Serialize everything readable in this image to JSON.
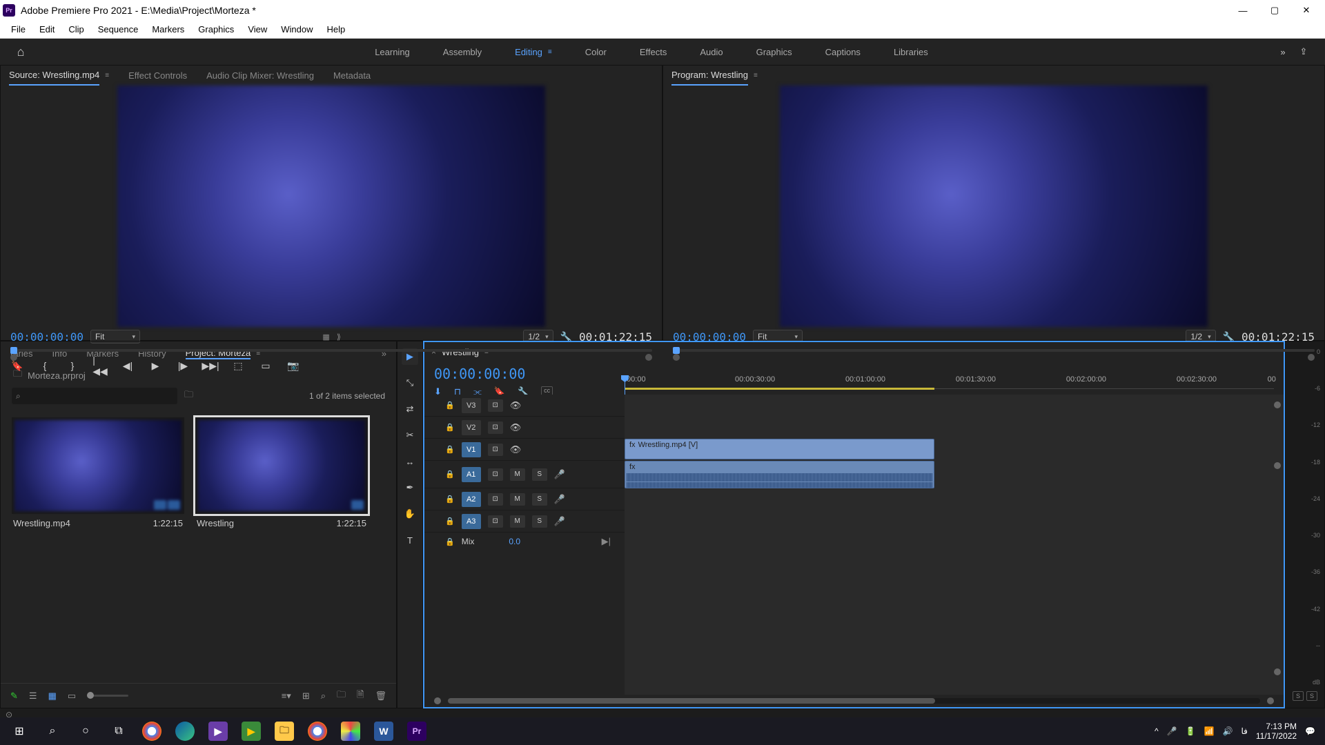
{
  "titlebar": {
    "app": "Pr",
    "title": "Adobe Premiere Pro 2021 - E:\\Media\\Project\\Morteza *"
  },
  "menubar": [
    "File",
    "Edit",
    "Clip",
    "Sequence",
    "Markers",
    "Graphics",
    "View",
    "Window",
    "Help"
  ],
  "workspaces": {
    "items": [
      "Learning",
      "Assembly",
      "Editing",
      "Color",
      "Effects",
      "Audio",
      "Graphics",
      "Captions",
      "Libraries"
    ],
    "active": 2
  },
  "source": {
    "tabs": [
      "Source: Wrestling.mp4",
      "Effect Controls",
      "Audio Clip Mixer: Wrestling",
      "Metadata"
    ],
    "timecode": "00:00:00:00",
    "fit": "Fit",
    "res": "1/2",
    "duration": "00:01:22:15"
  },
  "program": {
    "title": "Program: Wrestling",
    "timecode": "00:00:00:00",
    "fit": "Fit",
    "res": "1/2",
    "duration": "00:01:22:15"
  },
  "project": {
    "tabs": [
      "raries",
      "Info",
      "Markers",
      "History",
      "Project: Morteza"
    ],
    "active": 4,
    "file": "Morteza.prproj",
    "status": "1 of 2 items selected",
    "items": [
      {
        "name": "Wrestling.mp4",
        "dur": "1:22:15",
        "selected": false,
        "badges": 2
      },
      {
        "name": "Wrestling",
        "dur": "1:22:15",
        "selected": true,
        "badges": 1
      }
    ]
  },
  "timeline": {
    "sequence": "Wrestling",
    "timecode": "00:00:00:00",
    "ruler": [
      ":00:00",
      "00:00:30:00",
      "00:01:00:00",
      "00:01:30:00",
      "00:02:00:00",
      "00:02:30:00",
      "00"
    ],
    "v_tracks": [
      "V3",
      "V2",
      "V1"
    ],
    "a_tracks": [
      "A1",
      "A2",
      "A3"
    ],
    "mix": {
      "label": "Mix",
      "val": "0.0"
    },
    "clip_v": "Wrestling.mp4 [V]"
  },
  "meters": {
    "scale": [
      "0",
      "-6",
      "-12",
      "-18",
      "-24",
      "-30",
      "-36",
      "-42",
      "--",
      "dB"
    ]
  },
  "taskbar": {
    "time": "7:13 PM",
    "date": "11/17/2022",
    "lang": "فا"
  }
}
